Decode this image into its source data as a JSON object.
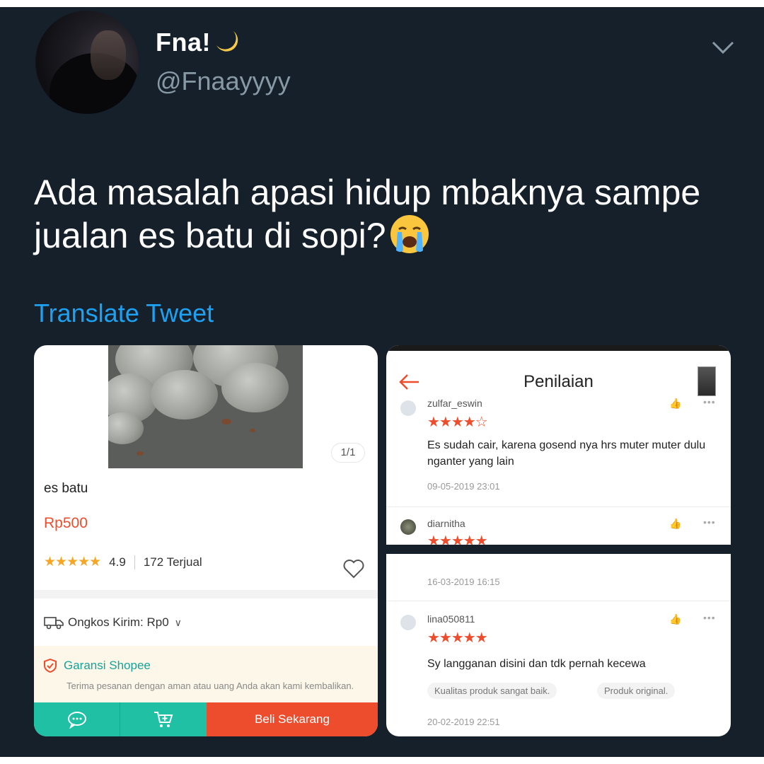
{
  "tweet": {
    "display_name": "Fna!",
    "handle": "@Fnaayyyy",
    "text": "Ada masalah apasi hidup mbaknya sampe jualan es batu di sopi?",
    "translate": "Translate Tweet"
  },
  "product": {
    "image_counter": "1/1",
    "name": "es batu",
    "price": "Rp500",
    "rating": "4.9",
    "sold": "172 Terjual",
    "shipping": "Ongkos Kirim: Rp0",
    "guarantee_title": "Garansi Shopee",
    "guarantee_desc": "Terima pesanan dengan aman atau uang Anda akan kami kembalikan.",
    "buy_label": "Beli Sekarang"
  },
  "reviews_top": {
    "title": "Penilaian",
    "items": [
      {
        "user": "zulfar_eswin",
        "stars": "★★★★☆",
        "text": "Es sudah cair, karena gosend nya hrs muter muter dulu nganter yang lain",
        "date": "09-05-2019 23:01"
      },
      {
        "user": "diarnitha",
        "stars": "★★★★★"
      }
    ]
  },
  "reviews_bottom": {
    "items": [
      {
        "date": "16-03-2019 16:15"
      },
      {
        "user": "lina050811",
        "stars": "★★★★★",
        "text": "Sy langganan disini dan tdk pernah kecewa",
        "tags": [
          "Kualitas produk sangat baik.",
          "Produk original."
        ],
        "date": "20-02-2019 22:51"
      }
    ]
  },
  "colors": {
    "tweet_bg": "#15202b",
    "link_blue": "#1da1f2",
    "shopee_orange": "#ee4d2d",
    "shopee_teal": "#1fc0a4"
  }
}
